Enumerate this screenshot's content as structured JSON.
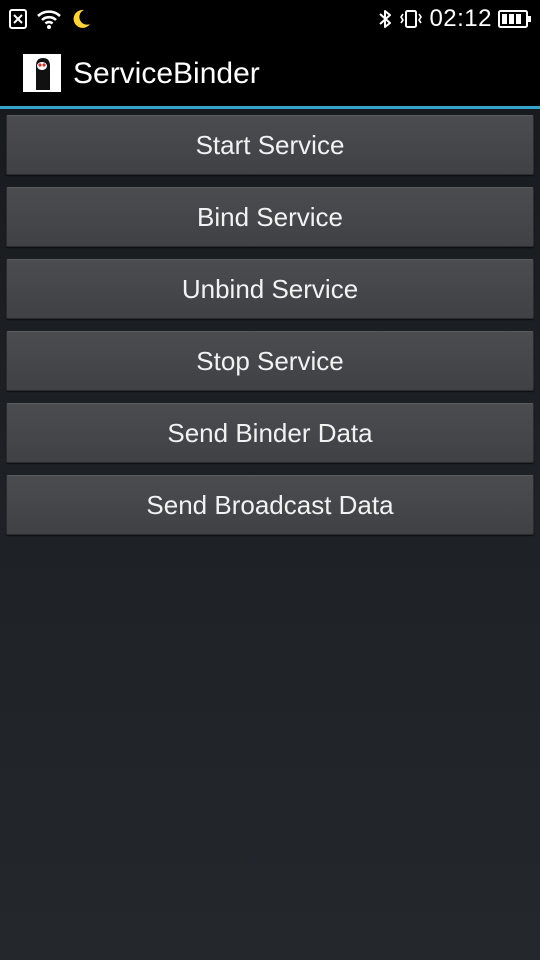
{
  "status_bar": {
    "time": "02:12",
    "left_icons": [
      "sim-off-icon",
      "wifi-icon",
      "night-mode-icon"
    ],
    "right_icons": [
      "bluetooth-icon",
      "vibrate-icon",
      "battery-icon"
    ]
  },
  "action_bar": {
    "title": "ServiceBinder",
    "accent_color": "#33a3cc"
  },
  "buttons": [
    {
      "label": "Start Service"
    },
    {
      "label": "Bind Service"
    },
    {
      "label": "Unbind Service"
    },
    {
      "label": "Stop Service"
    },
    {
      "label": "Send Binder Data"
    },
    {
      "label": "Send Broadcast Data"
    }
  ]
}
